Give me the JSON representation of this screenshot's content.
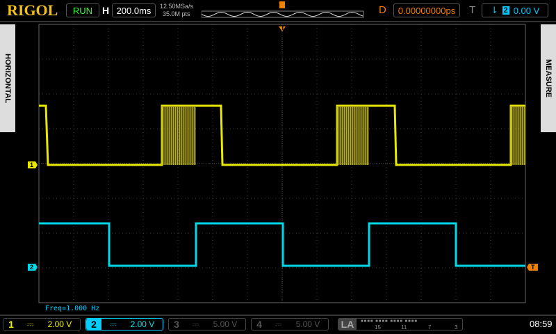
{
  "header": {
    "logo": "RIGOL",
    "run_state": "RUN",
    "h_label": "H",
    "timebase": "200.0ms",
    "sample_rate": "12.50MSa/s",
    "mem_depth": "35.0M pts",
    "trig_pos_marker": "T",
    "d_label": "D",
    "delay": "0.00000000ps",
    "t_label": "T",
    "trig_source": "2",
    "trig_level": "0.00 V",
    "trig_slope_icon": "falling-edge-icon"
  },
  "side": {
    "left": "HORIZONTAL",
    "right": "MEASURE"
  },
  "screen": {
    "ch1_marker": "1",
    "ch2_marker": "2",
    "trig_marker": "T",
    "measurement": "Freq=1.000 Hz"
  },
  "channels": [
    {
      "num": "1",
      "coupling": "⎓",
      "scale": "2.00 V",
      "color": "#f0f000",
      "active": true
    },
    {
      "num": "2",
      "coupling": "⎓",
      "scale": "2.00 V",
      "color": "#00e0f0",
      "active": true
    },
    {
      "num": "3",
      "coupling": "⎓",
      "scale": "5.00 V",
      "color": "#555555",
      "active": false
    },
    {
      "num": "4",
      "coupling": "⎓",
      "scale": "5.00 V",
      "color": "#555555",
      "active": false
    }
  ],
  "la": {
    "label": "LA",
    "ticks": [
      "15",
      "11",
      "7",
      "3"
    ]
  },
  "clock": "08:59"
}
